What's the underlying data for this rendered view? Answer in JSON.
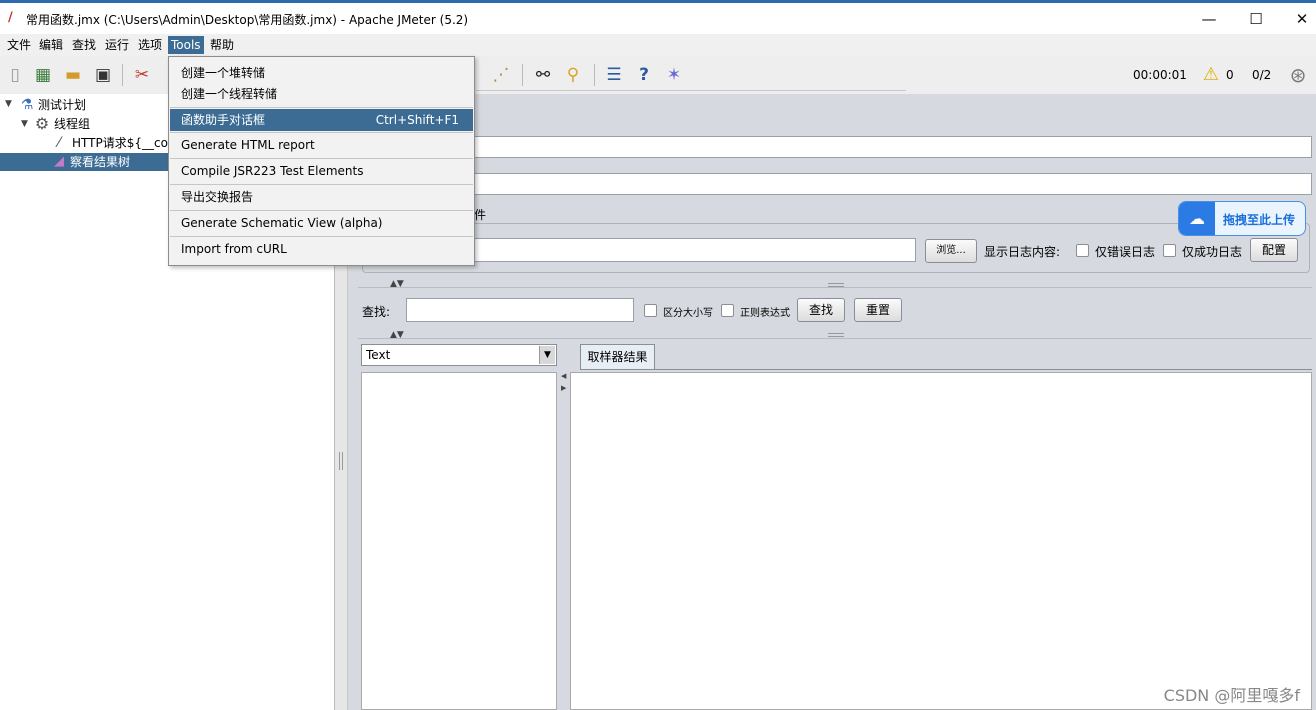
{
  "window": {
    "title": "常用函数.jmx (C:\\Users\\Admin\\Desktop\\常用函数.jmx) - Apache JMeter (5.2)",
    "minimize": "—",
    "maximize": "☐",
    "close": "✕"
  },
  "menubar": [
    "文件",
    "编辑",
    "查找",
    "运行",
    "选项",
    "Tools",
    "帮助"
  ],
  "tools_menu": {
    "items": [
      {
        "label": "创建一个堆转储",
        "shortcut": ""
      },
      {
        "label": "创建一个线程转储",
        "shortcut": ""
      },
      {
        "label": "函数助手对话框",
        "shortcut": "Ctrl+Shift+F1"
      },
      {
        "label": "Generate HTML report",
        "shortcut": ""
      },
      {
        "label": "Compile JSR223 Test Elements",
        "shortcut": ""
      },
      {
        "label": "导出交换报告",
        "shortcut": ""
      },
      {
        "label": "Generate Schematic View (alpha)",
        "shortcut": ""
      },
      {
        "label": "Import from cURL",
        "shortcut": ""
      }
    ]
  },
  "toolbar": {
    "timer": "00:00:01",
    "warnings": "0",
    "threads": "0/2"
  },
  "tree": {
    "items": [
      {
        "label": "测试计划"
      },
      {
        "label": "线程组"
      },
      {
        "label": "HTTP请求${__cou"
      },
      {
        "label": "察看结果树"
      }
    ]
  },
  "panel": {
    "file_partial": "件",
    "browse_label": "浏览...",
    "log_label": "显示日志内容:",
    "errors_only": "仅错误日志",
    "success_only": "仅成功日志",
    "configure": "配置",
    "search_label": "查找:",
    "case_sensitive": "区分大小写",
    "regex": "正则表达式",
    "search_button": "查找",
    "reset_button": "重置",
    "renderer": "Text",
    "tab_sampler_result": "取样器结果"
  },
  "upload_widget": "拖拽至此上传",
  "watermark": "CSDN @阿里嘎多f"
}
